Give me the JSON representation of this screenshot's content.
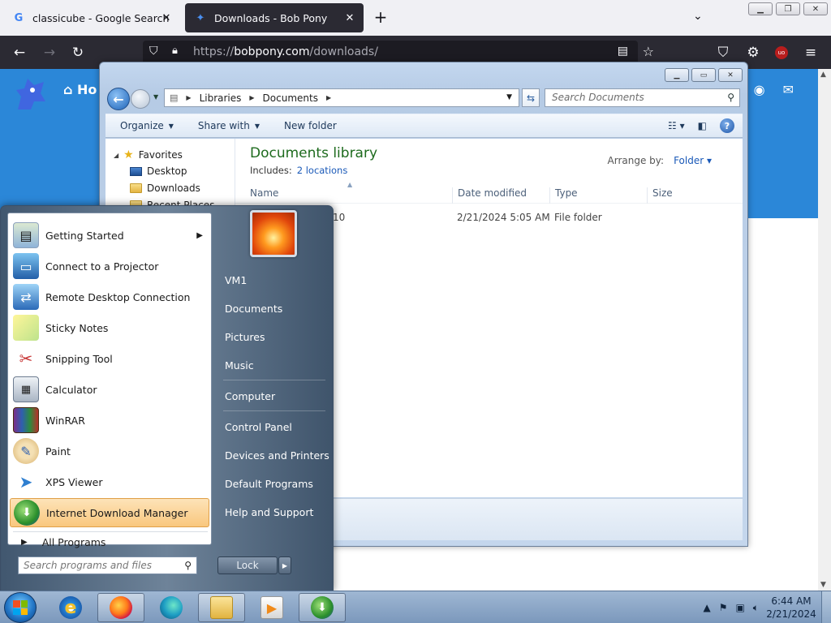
{
  "browser": {
    "tabs": [
      {
        "title": "classicube - Google Search",
        "favicon": "G"
      },
      {
        "title": "Downloads - Bob Pony",
        "favicon": "pony-icon"
      }
    ],
    "url_prefix": "https://",
    "url_domain": "bobpony.com",
    "url_path": "/downloads/",
    "page_nav": "Ho"
  },
  "explorer": {
    "breadcrumb": [
      "Libraries",
      "Documents"
    ],
    "search_placeholder": "Search Documents",
    "commands": {
      "organize": "Organize",
      "share": "Share with",
      "new_folder": "New folder"
    },
    "nav": {
      "favorites": "Favorites",
      "desktop": "Desktop",
      "downloads": "Downloads",
      "recent": "Recent Places"
    },
    "library_title": "Documents library",
    "includes_label": "Includes:",
    "includes_link": "2 locations",
    "arrange_label": "Arrange by:",
    "arrange_value": "Folder",
    "columns": {
      "name": "Name",
      "date": "Date modified",
      "type": "Type",
      "size": "Size"
    },
    "rows": [
      {
        "name_tail": "10",
        "date": "2/21/2024 5:05 AM",
        "type": "File folder"
      }
    ]
  },
  "start_menu": {
    "programs": [
      {
        "label": "Getting Started",
        "icon": "getting-started-icon",
        "submenu": true
      },
      {
        "label": "Connect to a Projector",
        "icon": "projector-icon"
      },
      {
        "label": "Remote Desktop Connection",
        "icon": "remote-desktop-icon"
      },
      {
        "label": "Sticky Notes",
        "icon": "sticky-notes-icon"
      },
      {
        "label": "Snipping Tool",
        "icon": "snipping-tool-icon"
      },
      {
        "label": "Calculator",
        "icon": "calculator-icon"
      },
      {
        "label": "WinRAR",
        "icon": "winrar-icon"
      },
      {
        "label": "Paint",
        "icon": "paint-icon"
      },
      {
        "label": "XPS Viewer",
        "icon": "xps-viewer-icon"
      },
      {
        "label": "Internet Download Manager",
        "icon": "idm-icon",
        "highlighted": true
      }
    ],
    "all_programs": "All Programs",
    "search_placeholder": "Search programs and files",
    "right": [
      "VM1",
      "Documents",
      "Pictures",
      "Music",
      "Computer",
      "Control Panel",
      "Devices and Printers",
      "Default Programs",
      "Help and Support"
    ],
    "lock": "Lock"
  },
  "taskbar": {
    "apps": [
      "internet-explorer-icon",
      "firefox-icon",
      "edge-icon",
      "explorer-icon",
      "media-player-icon",
      "idm-icon"
    ],
    "time": "6:44 AM",
    "date": "2/21/2024"
  }
}
